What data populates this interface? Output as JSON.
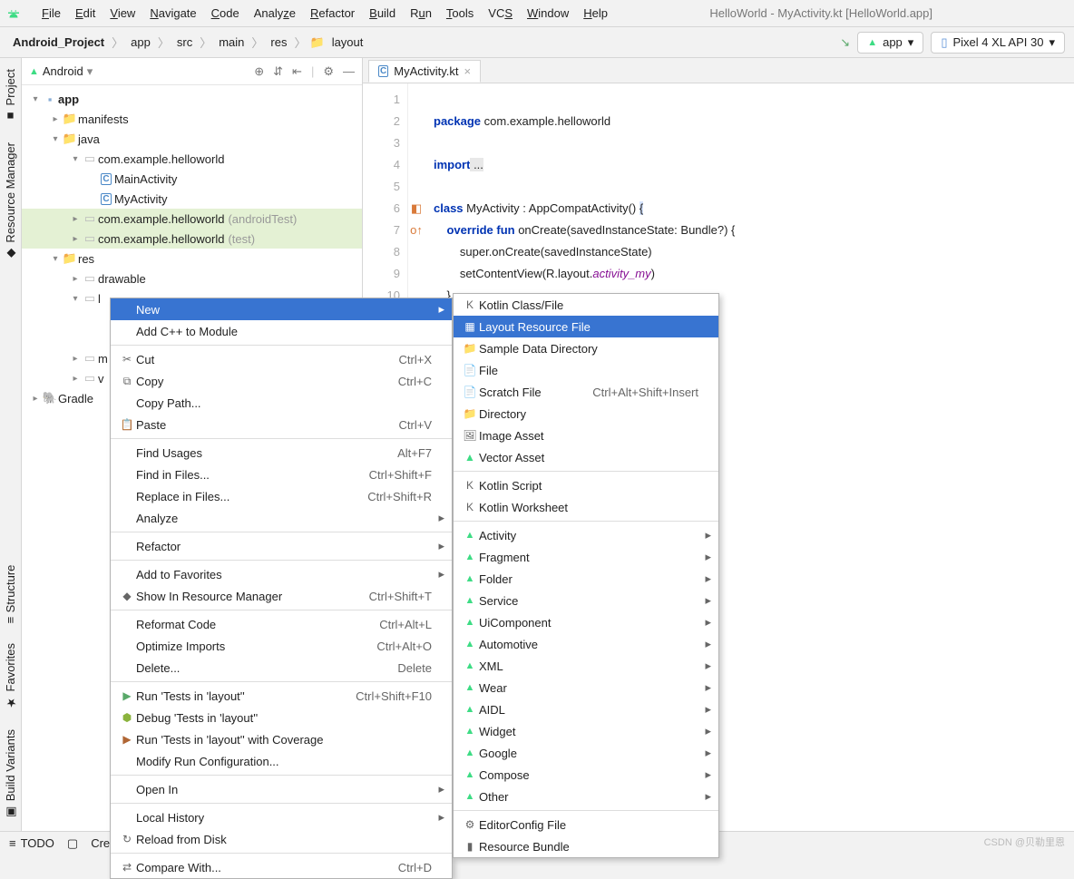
{
  "window_title": "HelloWorld - MyActivity.kt [HelloWorld.app]",
  "menu": [
    "File",
    "Edit",
    "View",
    "Navigate",
    "Code",
    "Analyze",
    "Refactor",
    "Build",
    "Run",
    "Tools",
    "VCS",
    "Window",
    "Help"
  ],
  "breadcrumb": [
    "Android_Project",
    "app",
    "src",
    "main",
    "res",
    "layout"
  ],
  "config_selector": "app",
  "device_selector": "Pixel 4 XL API 30",
  "panel_title": "Android",
  "tree": {
    "app": "app",
    "manifests": "manifests",
    "java": "java",
    "pkg1": "com.example.helloworld",
    "main_act": "MainActivity",
    "my_act": "MyActivity",
    "pkg2": "com.example.helloworld",
    "pkg2_suffix": "(androidTest)",
    "pkg3": "com.example.helloworld",
    "pkg3_suffix": "(test)",
    "res": "res",
    "drawable": "drawable",
    "layout_partial": "l",
    "m_partial": "m",
    "v_partial": "v",
    "gradle": "Gradle"
  },
  "sidebar_tabs": {
    "project": "Project",
    "resmgr": "Resource Manager",
    "structure": "Structure",
    "favorites": "Favorites",
    "variants": "Build Variants"
  },
  "editor_tab": "MyActivity.kt",
  "line_numbers": [
    "1",
    "2",
    "3",
    "4",
    "5",
    "6",
    "7",
    "8",
    "9",
    "10",
    ""
  ],
  "code": {
    "l1_kw": "package",
    "l1_rest": " com.example.helloworld",
    "l3_kw": "import",
    "l3_rest": " ...",
    "l6_a": "class ",
    "l6_b": "MyActivity : AppCompatActivity() ",
    "l6_c": "{",
    "l7_a": "    override fun ",
    "l7_b": "onCreate(savedInstanceState: Bundle?) {",
    "l8": "        super.onCreate(savedInstanceState)",
    "l9_a": "        setContentView(R.layout.",
    "l9_b": "activity_my",
    "l9_c": ")",
    "l10": "    }"
  },
  "ctx1": [
    {
      "label": "New",
      "arrow": true,
      "selected": true
    },
    {
      "label": "Add C++ to Module"
    },
    {
      "sep": true
    },
    {
      "icon": "✂",
      "label": "Cut",
      "sc": "Ctrl+X"
    },
    {
      "icon": "⧉",
      "label": "Copy",
      "sc": "Ctrl+C"
    },
    {
      "label": "Copy Path..."
    },
    {
      "icon": "📋",
      "label": "Paste",
      "sc": "Ctrl+V"
    },
    {
      "sep": true
    },
    {
      "label": "Find Usages",
      "sc": "Alt+F7"
    },
    {
      "label": "Find in Files...",
      "sc": "Ctrl+Shift+F"
    },
    {
      "label": "Replace in Files...",
      "sc": "Ctrl+Shift+R"
    },
    {
      "label": "Analyze",
      "arrow": true
    },
    {
      "sep": true
    },
    {
      "label": "Refactor",
      "arrow": true
    },
    {
      "sep": true
    },
    {
      "label": "Add to Favorites",
      "arrow": true
    },
    {
      "icon": "◆",
      "label": "Show In Resource Manager",
      "sc": "Ctrl+Shift+T"
    },
    {
      "sep": true
    },
    {
      "label": "Reformat Code",
      "sc": "Ctrl+Alt+L"
    },
    {
      "label": "Optimize Imports",
      "sc": "Ctrl+Alt+O"
    },
    {
      "label": "Delete...",
      "sc": "Delete"
    },
    {
      "sep": true
    },
    {
      "icon": "▶",
      "label": "Run 'Tests in 'layout''",
      "sc": "Ctrl+Shift+F10",
      "iconColor": "#59a869"
    },
    {
      "icon": "⬢",
      "label": "Debug 'Tests in 'layout''",
      "iconColor": "#8bb33d"
    },
    {
      "icon": "▶",
      "label": "Run 'Tests in 'layout'' with Coverage",
      "iconColor": "#b06634"
    },
    {
      "label": "Modify Run Configuration..."
    },
    {
      "sep": true
    },
    {
      "label": "Open In",
      "arrow": true
    },
    {
      "sep": true
    },
    {
      "label": "Local History",
      "arrow": true
    },
    {
      "icon": "↻",
      "label": "Reload from Disk"
    },
    {
      "sep": true
    },
    {
      "icon": "⇄",
      "label": "Compare With...",
      "sc": "Ctrl+D"
    }
  ],
  "ctx2": [
    {
      "icon": "K",
      "label": "Kotlin Class/File"
    },
    {
      "icon": "▦",
      "label": "Layout Resource File",
      "selected": true
    },
    {
      "icon": "📁",
      "label": "Sample Data Directory"
    },
    {
      "icon": "📄",
      "label": "File"
    },
    {
      "icon": "📄",
      "label": "Scratch File",
      "sc": "Ctrl+Alt+Shift+Insert"
    },
    {
      "icon": "📁",
      "label": "Directory"
    },
    {
      "icon": "🖼",
      "label": "Image Asset"
    },
    {
      "icon": "▲",
      "label": "Vector Asset",
      "iconColor": "#3ddc84"
    },
    {
      "sep": true
    },
    {
      "icon": "K",
      "label": "Kotlin Script"
    },
    {
      "icon": "K",
      "label": "Kotlin Worksheet"
    },
    {
      "sep": true
    },
    {
      "icon": "▲",
      "label": "Activity",
      "arrow": true,
      "android": true
    },
    {
      "icon": "▲",
      "label": "Fragment",
      "arrow": true,
      "android": true
    },
    {
      "icon": "▲",
      "label": "Folder",
      "arrow": true,
      "android": true
    },
    {
      "icon": "▲",
      "label": "Service",
      "arrow": true,
      "android": true
    },
    {
      "icon": "▲",
      "label": "UiComponent",
      "arrow": true,
      "android": true
    },
    {
      "icon": "▲",
      "label": "Automotive",
      "arrow": true,
      "android": true
    },
    {
      "icon": "▲",
      "label": "XML",
      "arrow": true,
      "android": true
    },
    {
      "icon": "▲",
      "label": "Wear",
      "arrow": true,
      "android": true
    },
    {
      "icon": "▲",
      "label": "AIDL",
      "arrow": true,
      "android": true
    },
    {
      "icon": "▲",
      "label": "Widget",
      "arrow": true,
      "android": true
    },
    {
      "icon": "▲",
      "label": "Google",
      "arrow": true,
      "android": true
    },
    {
      "icon": "▲",
      "label": "Compose",
      "arrow": true,
      "android": true
    },
    {
      "icon": "▲",
      "label": "Other",
      "arrow": true,
      "android": true
    },
    {
      "sep": true
    },
    {
      "icon": "⚙",
      "label": "EditorConfig File"
    },
    {
      "icon": "▮",
      "label": "Resource Bundle"
    }
  ],
  "status": {
    "todo": "TODO",
    "create": "Create a new"
  },
  "watermark": "CSDN @贝勒里恩"
}
